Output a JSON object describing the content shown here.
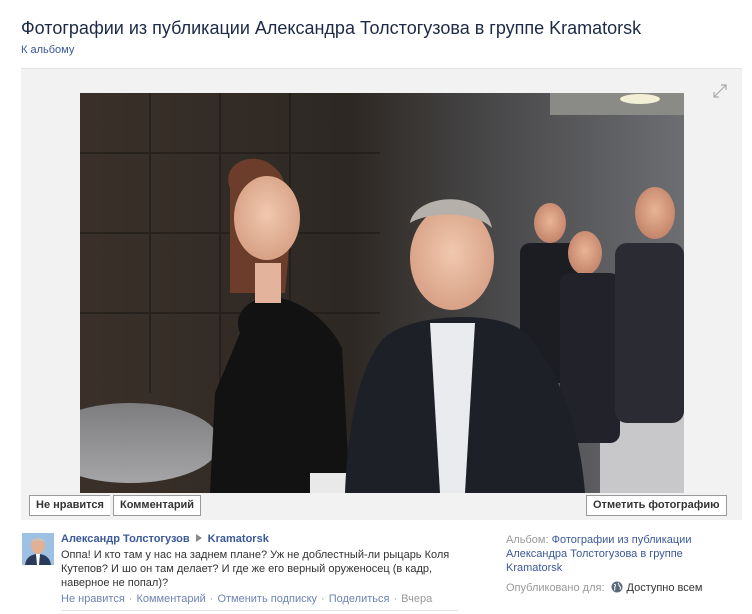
{
  "header": {
    "title": "Фотографии из публикации Александра Толстогузова в группе Kramatorsk",
    "back_link": "К альбому"
  },
  "photo_actions": {
    "like_label": "Не нравится",
    "comment_label": "Комментарий",
    "tag_label": "Отметить фотографию"
  },
  "post": {
    "author": "Александр Толстогузов",
    "group": "Kramatorsk",
    "text": "Оппа! И кто там у нас на заднем плане? Уж не доблестный-ли рыцарь Коля Кутепов? И шо он там делает? И где же его верный оруженосец (в кадр, наверное не попал)?",
    "actions": {
      "unlike": "Не нравится",
      "comment": "Комментарий",
      "unfollow": "Отменить подписку",
      "share": "Поделиться",
      "time": "Вчера"
    }
  },
  "sidebar": {
    "album_label": "Альбом:",
    "album_link": "Фотографии из публикации Александра Толстогузова в группе Kramatorsk",
    "published_label": "Опубликовано для:",
    "audience": "Доступно всем"
  },
  "colors": {
    "link": "#3b5998",
    "title": "#1c2a47",
    "stage_bg": "#f2f2f2"
  },
  "icons": [
    "expand-icon",
    "globe-icon",
    "arrow-right-icon"
  ]
}
